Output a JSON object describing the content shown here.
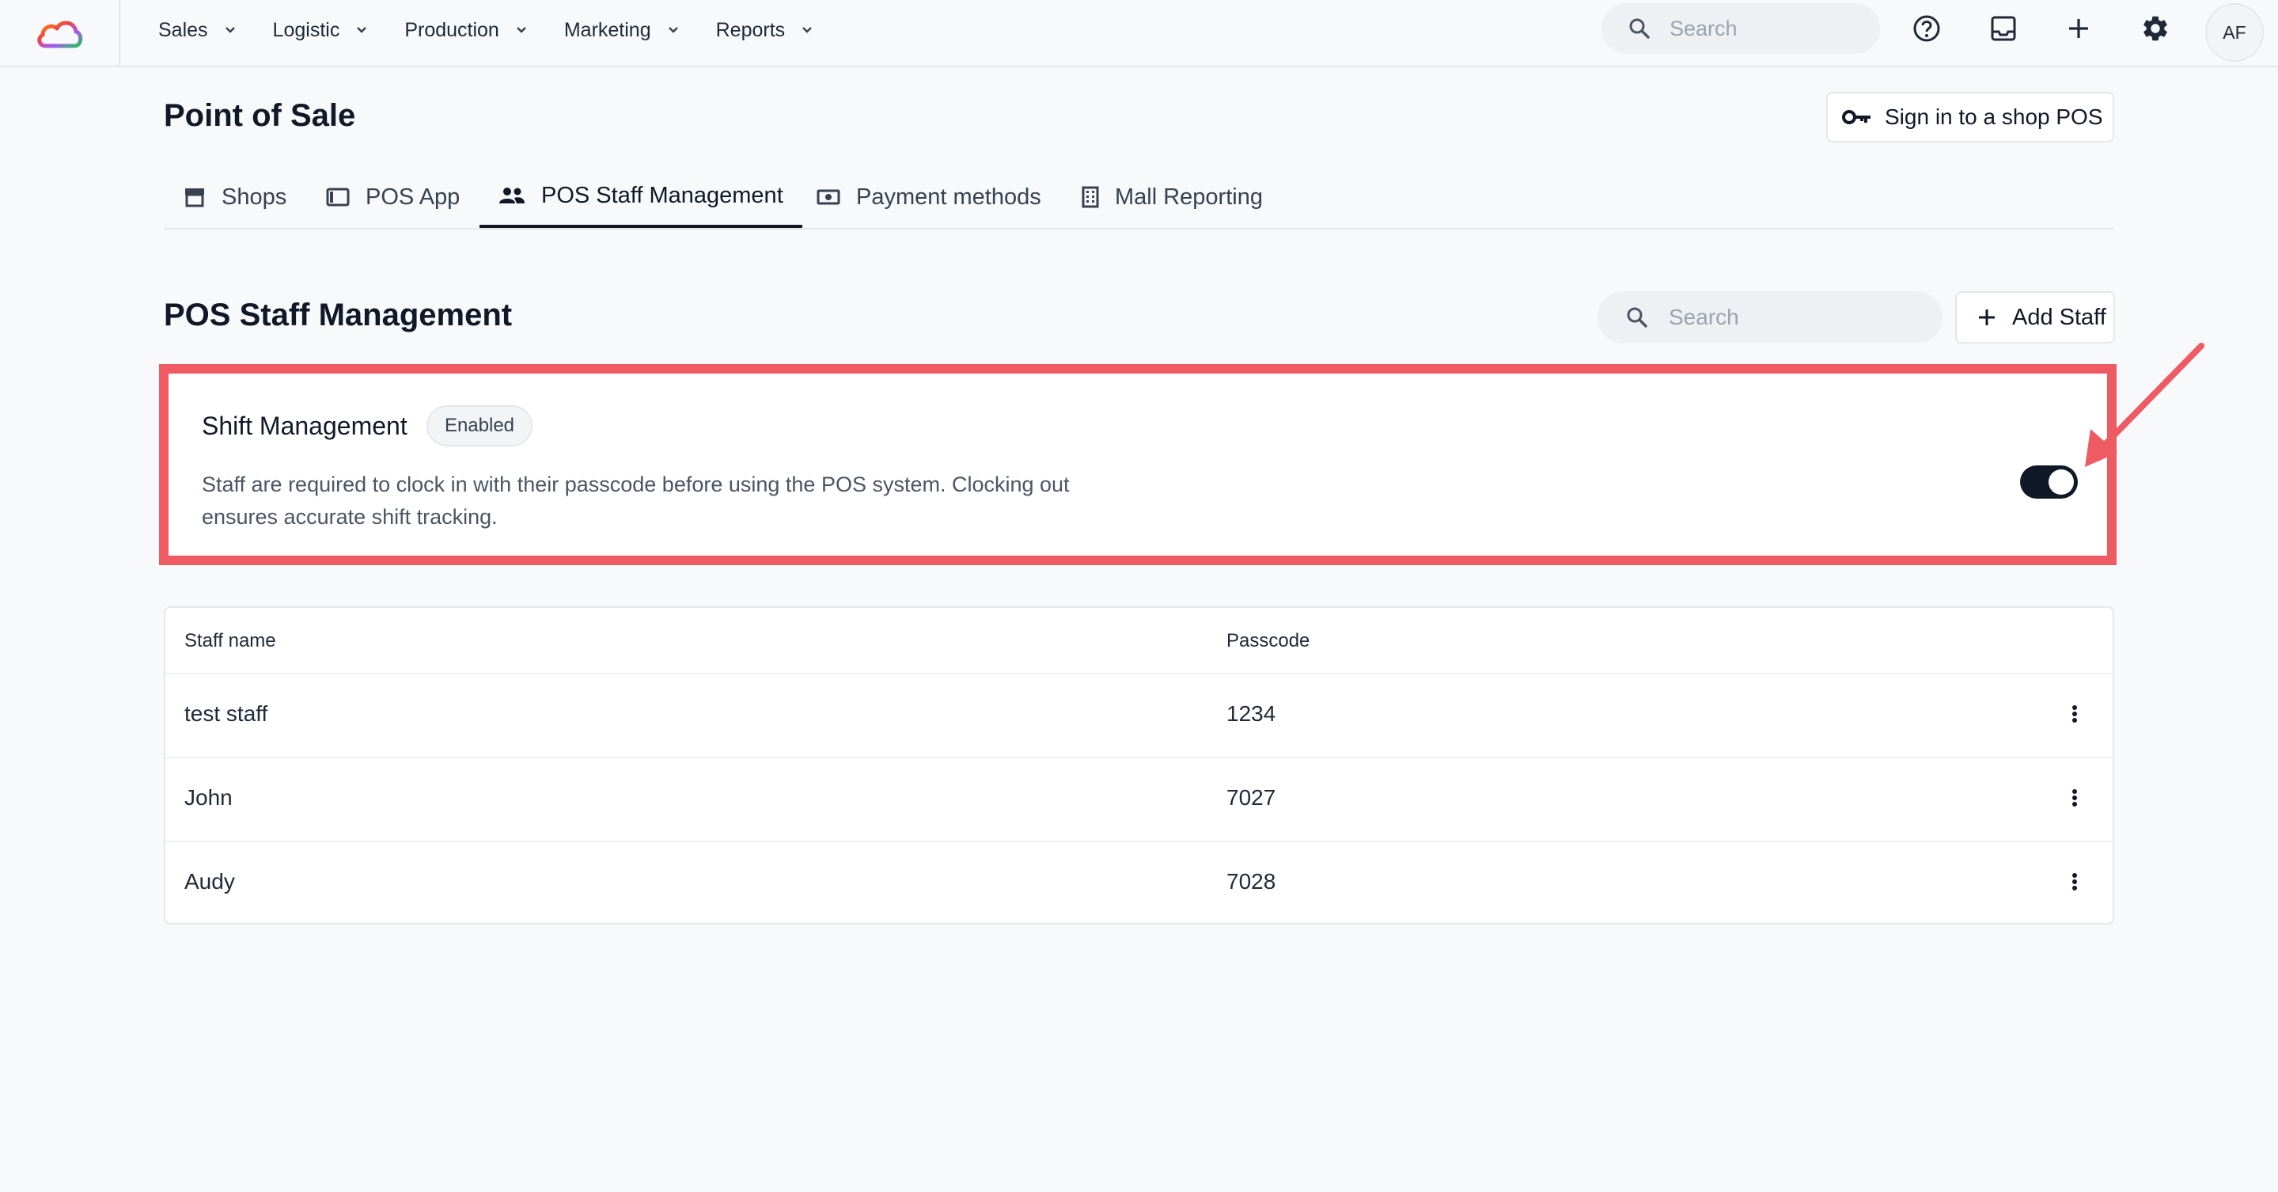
{
  "nav": {
    "items": [
      {
        "label": "Sales"
      },
      {
        "label": "Logistic"
      },
      {
        "label": "Production"
      },
      {
        "label": "Marketing"
      },
      {
        "label": "Reports"
      }
    ],
    "search_placeholder": "Search",
    "avatar_initials": "AF"
  },
  "page": {
    "title": "Point of Sale",
    "signin_button": "Sign in to a shop POS"
  },
  "tabs": [
    {
      "label": "Shops",
      "icon": "store-icon"
    },
    {
      "label": "POS App",
      "icon": "tablet-icon"
    },
    {
      "label": "POS Staff Management",
      "icon": "people-icon",
      "active": true
    },
    {
      "label": "Payment methods",
      "icon": "money-icon"
    },
    {
      "label": "Mall Reporting",
      "icon": "building-icon"
    }
  ],
  "section": {
    "title": "POS Staff Management",
    "search_placeholder": "Search",
    "add_button": "Add Staff"
  },
  "shift": {
    "title": "Shift Management",
    "badge": "Enabled",
    "description": "Staff are required to clock in with their passcode before using the POS system. Clocking out ensures accurate shift tracking.",
    "toggle_on": true
  },
  "table": {
    "headers": {
      "name": "Staff name",
      "passcode": "Passcode"
    },
    "rows": [
      {
        "name": "test staff",
        "passcode": "1234"
      },
      {
        "name": "John",
        "passcode": "7027"
      },
      {
        "name": "Audy",
        "passcode": "7028"
      }
    ]
  },
  "colors": {
    "highlight": "#ef5b63",
    "toggle": "#111827"
  }
}
